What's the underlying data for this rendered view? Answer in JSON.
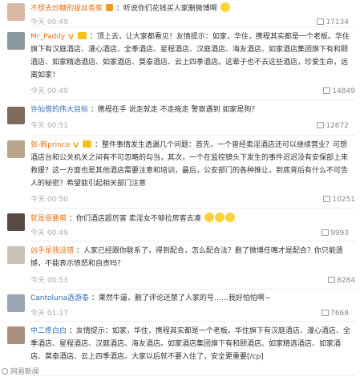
{
  "comments": [
    {
      "user": "不想去炒糖的拔丝香蕉",
      "text": "：听说你们花钱买人家删微博啊",
      "time": "今天 00:49",
      "likes": "17134"
    },
    {
      "user": "Mr_Paddy",
      "text": "：顶上去，让大家都看见！友情提示：如家，华住，携程其实都是一个老板。华住旗下有汉庭酒店、漫心酒店、全季酒店、星程酒店、汉庭酒店、海友酒店、如家酒店集团旗下有和颐酒店、如家精选酒店、如家酒店、莫泰酒店、云上四季酒店。这辈子也不去这些酒店，珍爱生命，远离如家！",
      "time": "今天 00:49",
      "likes": "14849"
    },
    {
      "user": "许仙僧的伟大目标",
      "text": "：携程在手 说走就走 不走拖走 警察遇到 如家是狗？",
      "time": "今天 00:51",
      "likes": "12672"
    },
    {
      "user": "张-毅prince",
      "text": "：整件事情发生透漏几个问题：首先，一个曾经卖淫酒店还可以继续营业？可想酒店台和公关机关之间有不可忽略的勾当，其次，一个在监控镜头下发生的事件迟迟没有安保部上来救援？这一方面也是其他酒店需要注意和培训，最后，公安部门的各种推让，到底背后有什么不可告人的秘密？希望能引起相关部门注意",
      "time": "今天 00:50",
      "likes": "10251"
    },
    {
      "user": "就是很要萌",
      "text": "：你们酒店超厉害 卖淫女不够拉房客去凑",
      "time": "今天 00:49",
      "likes": "9993"
    },
    {
      "user": "凶手是我没错",
      "text": "：人家已经跟你联系了，得到配合，怎么配合法？删了微博任嘴才是配合？你只能遗憾，不能表示愤怒和自责吗？",
      "time": "今天 00:53",
      "likes": "8284"
    },
    {
      "user": "Cantoluna选游泰",
      "text": "：果然牛逼，删了评论还禁了人家的号……我好怕怕啊~",
      "time": "今天 01:17",
      "likes": "7668"
    },
    {
      "user": "中二佟白白",
      "text": "：友情提示：如家，华住，携程其实都是一个老板。华住旗下有汉庭酒店、漫心酒店、全季酒店、星程酒店、汉庭酒店、海友酒店。如家酒店集团旗下有和颐酒店、如家精选酒店、如家酒店、莫泰酒店、云上四季酒店。大家以后就不要入住了，安全更重要[/cp]",
      "time": "",
      "likes": ""
    }
  ],
  "watermark": "网易新闻",
  "colors": {
    "username": "#e8721a",
    "username_alt": "#2f6fb4",
    "meta": "#aaaaaa"
  }
}
